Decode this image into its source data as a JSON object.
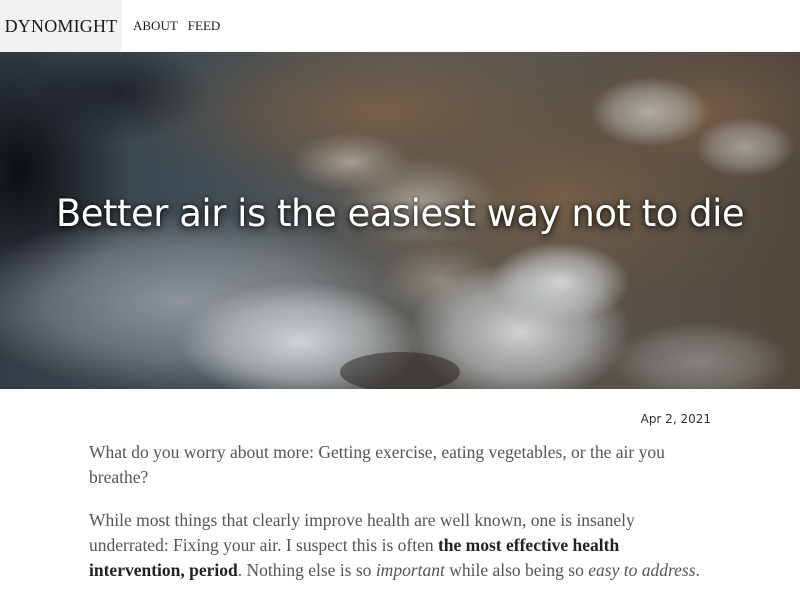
{
  "nav": {
    "brand": "DYNOMIGHT",
    "links": [
      "ABOUT",
      "FEED"
    ]
  },
  "hero": {
    "title": "Better air is the easiest way not to die",
    "image_icon": "satellite-earth-image"
  },
  "post": {
    "date": "Apr 2, 2021",
    "p1": "What do you worry about more: Getting exercise, eating vegetables, or the air you breathe?",
    "p2_part1": "While most things that clearly improve health are well known, one is insanely underrated: Fixing your air. I suspect this is often ",
    "p2_bold": "the most effective health intervention, period",
    "p2_part2": ". Nothing else is so ",
    "p2_em1": "important",
    "p2_part3": " while also being so ",
    "p2_em2": "easy to address",
    "p2_end": "."
  },
  "colors": {
    "brand_bg": "#f2f2f2",
    "text": "#555555",
    "title": "#ffffff"
  }
}
